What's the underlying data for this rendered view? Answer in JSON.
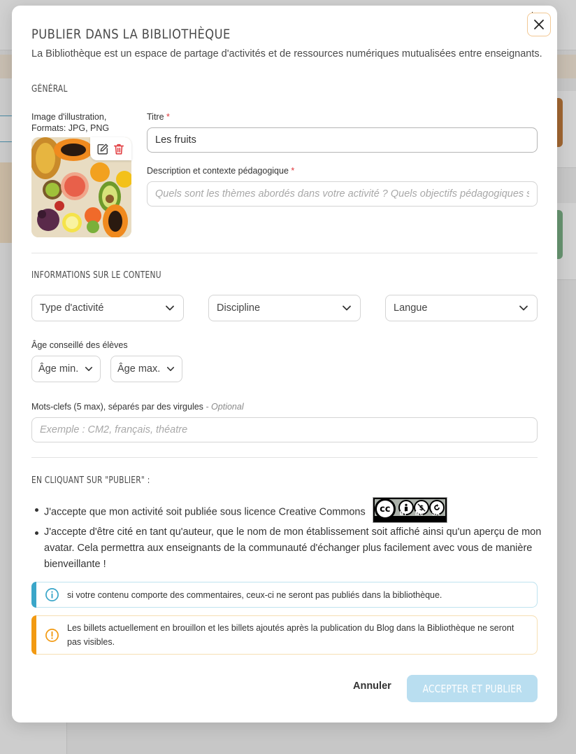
{
  "dialog": {
    "title": "Publier dans la bibliothèque",
    "subtitle": "La Bibliothèque est un espace de partage d'activités et de ressources numériques mutualisées entre enseignants.",
    "close_icon": "close-icon"
  },
  "general": {
    "section_title": "Général",
    "image_label_line1": "Image d'illustration,",
    "image_label_line2": "Formats: JPG, PNG",
    "image_alt_subject": "fruits",
    "title_label": "Titre",
    "title_required": "*",
    "title_value": "Les fruits",
    "description_label": "Description et contexte pédagogique",
    "description_required": "*",
    "description_placeholder": "Quels sont les thèmes abordés dans votre activité ? Quels objectifs pédagogiques sont visés ?"
  },
  "content_info": {
    "section_title": "Informations sur le contenu",
    "activity_type": "Type d'activité",
    "discipline": "Discipline",
    "language": "Langue",
    "age_label": "Âge conseillé des élèves",
    "age_min": "Âge min.",
    "age_max": "Âge max.",
    "keywords_label": "Mots-clefs (5 max), séparés par des virgules",
    "keywords_optional": "- Optional",
    "keywords_placeholder": "Exemple : CM2, français, théatre"
  },
  "consent": {
    "section_title": "En cliquant sur \"publier\" :",
    "item1": "J'accepte que mon activité soit publiée sous licence Creative Commons",
    "item2": "J'accepte d'être cité en tant qu'auteur, que le nom de mon établissement soit affiché ainsi qu'un aperçu de mon avatar. Cela permettra aux enseignants de la communauté d'échanger plus facilement avec vous de manière bienveillante !",
    "cc_logo_text": "cc",
    "cc_by": "BY",
    "cc_nc": "NC",
    "cc_sa": "SA"
  },
  "alerts": {
    "info_text": "si votre contenu comporte des commentaires, ceux-ci ne seront pas publiés dans la bibliothèque.",
    "warning_text": "Les billets actuellement en brouillon et les billets ajoutés après la publication du Blog dans la Bibliothèque ne seront pas visibles."
  },
  "actions": {
    "cancel": "Annuler",
    "publish": "Accepter et publier"
  },
  "colors": {
    "info_accent": "#3aa6c9",
    "warning_accent": "#f29a12",
    "publish_disabled_bg": "#b9def0",
    "required": "#e0373b",
    "delete_icon": "#e0373b"
  }
}
